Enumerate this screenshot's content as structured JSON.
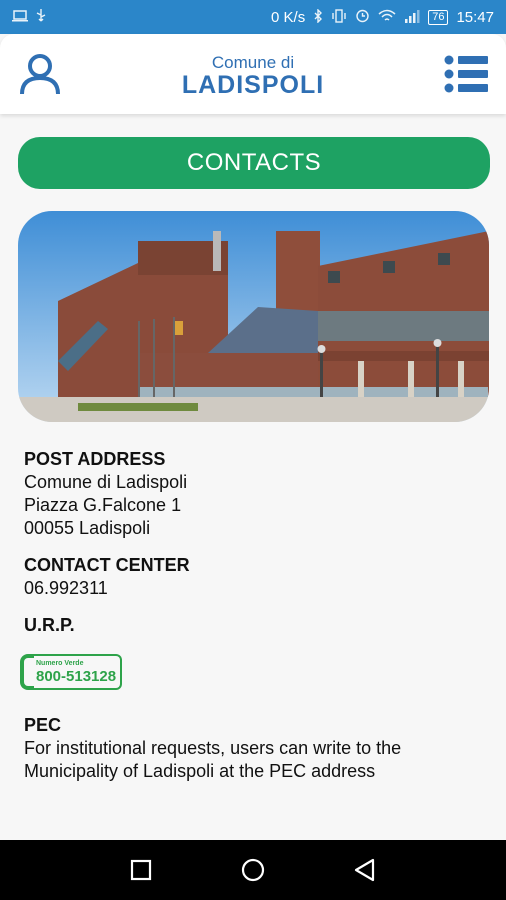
{
  "status_bar": {
    "left_icons": [
      "laptop-icon",
      "usb-icon"
    ],
    "net_speed": "0 K/s",
    "battery": "76",
    "time": "15:47"
  },
  "header": {
    "logo_sub": "Comune di",
    "logo_main": "LADISPOLI",
    "user_icon": "user-icon",
    "menu_icon": "menu-list-icon"
  },
  "main": {
    "contacts_button": "CONTACTS",
    "photo": "town-hall-building-photo",
    "post_address": {
      "heading": "POST ADDRESS",
      "lines": [
        "Comune di Ladispoli",
        "Piazza G.Falcone 1",
        "00055 Ladispoli"
      ]
    },
    "contact_center": {
      "heading": "CONTACT CENTER",
      "phone": "06.992311"
    },
    "urp": {
      "heading": "U.R.P.",
      "badge_top": "Numero Verde",
      "badge_number": "800-513128"
    },
    "pec": {
      "heading": "PEC",
      "text": "For institutional requests, users can write to the Municipality of Ladispoli at the PEC address"
    }
  },
  "colors": {
    "status_bar": "#2b86c9",
    "brand_blue": "#2f6fb3",
    "accent_green": "#1ea263",
    "badge_green": "#2ea34a"
  },
  "nav_bar": {
    "buttons": [
      "recent-apps-icon",
      "home-icon",
      "back-icon"
    ]
  }
}
